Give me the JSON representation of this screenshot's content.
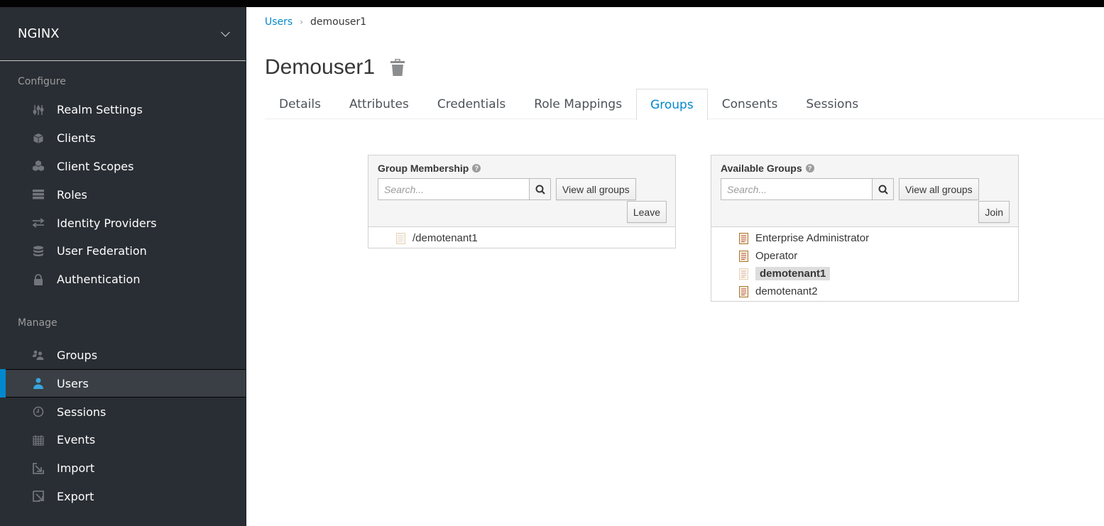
{
  "sidebar": {
    "realm": "NGINX",
    "configure_label": "Configure",
    "configure_items": [
      {
        "label": "Realm Settings",
        "icon": "sliders-icon"
      },
      {
        "label": "Clients",
        "icon": "cube-icon"
      },
      {
        "label": "Client Scopes",
        "icon": "cubes-icon"
      },
      {
        "label": "Roles",
        "icon": "server-icon"
      },
      {
        "label": "Identity Providers",
        "icon": "exchange-icon"
      },
      {
        "label": "User Federation",
        "icon": "database-icon"
      },
      {
        "label": "Authentication",
        "icon": "lock-icon"
      }
    ],
    "manage_label": "Manage",
    "manage_items": [
      {
        "label": "Groups",
        "icon": "users-icon"
      },
      {
        "label": "Users",
        "icon": "user-icon",
        "active": true
      },
      {
        "label": "Sessions",
        "icon": "clock-icon"
      },
      {
        "label": "Events",
        "icon": "calendar-icon"
      },
      {
        "label": "Import",
        "icon": "import-icon"
      },
      {
        "label": "Export",
        "icon": "export-icon"
      }
    ]
  },
  "breadcrumb": {
    "parent": "Users",
    "current": "demouser1"
  },
  "page": {
    "title": "Demouser1"
  },
  "tabs": [
    {
      "label": "Details"
    },
    {
      "label": "Attributes"
    },
    {
      "label": "Credentials"
    },
    {
      "label": "Role Mappings"
    },
    {
      "label": "Groups",
      "active": true
    },
    {
      "label": "Consents"
    },
    {
      "label": "Sessions"
    }
  ],
  "membership": {
    "title": "Group Membership",
    "search_placeholder": "Search...",
    "view_all": "View all groups",
    "action": "Leave",
    "groups": [
      "/demotenant1"
    ]
  },
  "available": {
    "title": "Available Groups",
    "search_placeholder": "Search...",
    "view_all": "View all groups",
    "action": "Join",
    "groups": [
      "Enterprise Administrator",
      "Operator",
      "demotenant1",
      "demotenant2"
    ],
    "selected": "demotenant1"
  },
  "colors": {
    "accent": "#0088ce",
    "sidebar_bg": "#292e34",
    "active_item_bg": "#393f44"
  }
}
